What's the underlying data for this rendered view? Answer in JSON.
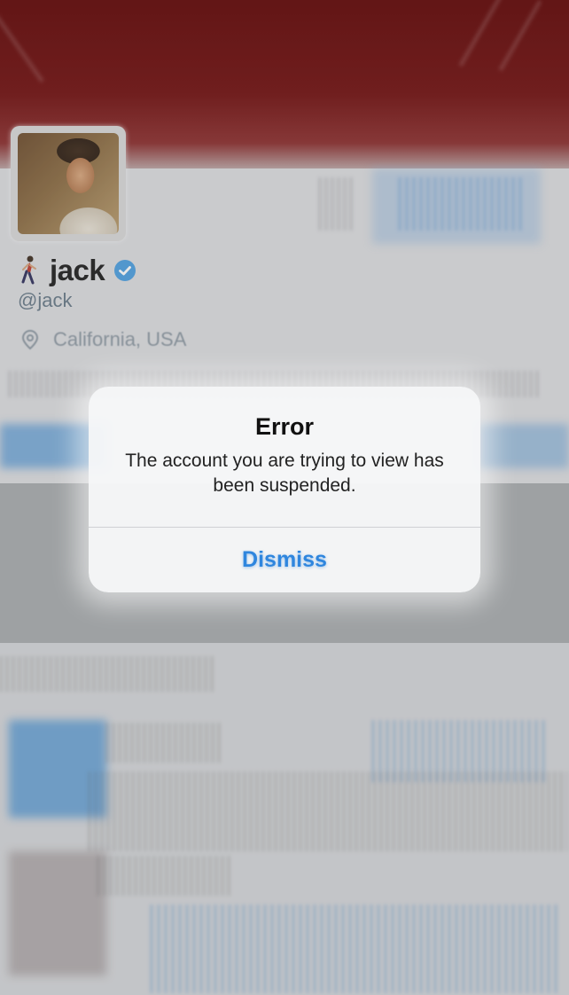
{
  "profile": {
    "name": "jack",
    "handle": "@jack",
    "location": "California, USA",
    "name_emoji_icon": "person-walking-icon",
    "verified_icon": "verified-badge-icon",
    "location_icon": "map-pin-icon"
  },
  "alert": {
    "title": "Error",
    "message": "The account you are trying to view has been suspended.",
    "dismiss_label": "Dismiss"
  },
  "colors": {
    "banner": "#5e0000",
    "link_blue": "#2f86de",
    "verified_blue": "#4a9ee0",
    "handle_gray": "#657786"
  }
}
